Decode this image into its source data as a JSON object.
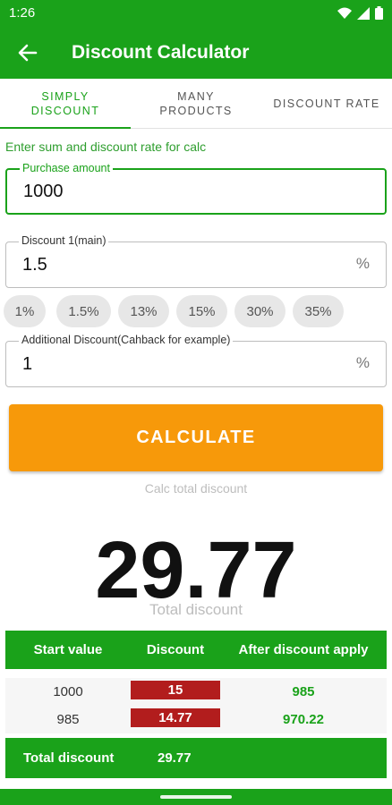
{
  "status": {
    "time": "1:26"
  },
  "appbar": {
    "title": "Discount Calculator"
  },
  "tabs": [
    {
      "label": "SIMPLY\nDISCOUNT"
    },
    {
      "label": "MANY\nPRODUCTS"
    },
    {
      "label": "DISCOUNT RATE"
    }
  ],
  "hint": "Enter sum and discount rate for calc",
  "purchase": {
    "label": "Purchase amount",
    "value": "1000"
  },
  "discount1": {
    "label": "Discount 1(main)",
    "value": "1.5",
    "unit": "%"
  },
  "chips": [
    "1%",
    "1.5%",
    "13%",
    "15%",
    "30%",
    "35%"
  ],
  "additional": {
    "label": "Additional Discount(Cahback for example)",
    "value": "1",
    "unit": "%"
  },
  "calculate": {
    "label": "CALCULATE",
    "caption": "Calc total discount"
  },
  "result": {
    "value": "29.77",
    "caption": "Total discount"
  },
  "table": {
    "headers": [
      "Start value",
      "Discount",
      "After discount apply"
    ],
    "rows": [
      {
        "start": "1000",
        "discount": "15",
        "after": "985"
      },
      {
        "start": "985",
        "discount": "14.77",
        "after": "970.22"
      }
    ],
    "footer": {
      "label": "Total discount",
      "value": "29.77"
    }
  },
  "colors": {
    "primary": "#1aa21a",
    "accent": "#f7990a",
    "discount_cell": "#b21d1d"
  }
}
